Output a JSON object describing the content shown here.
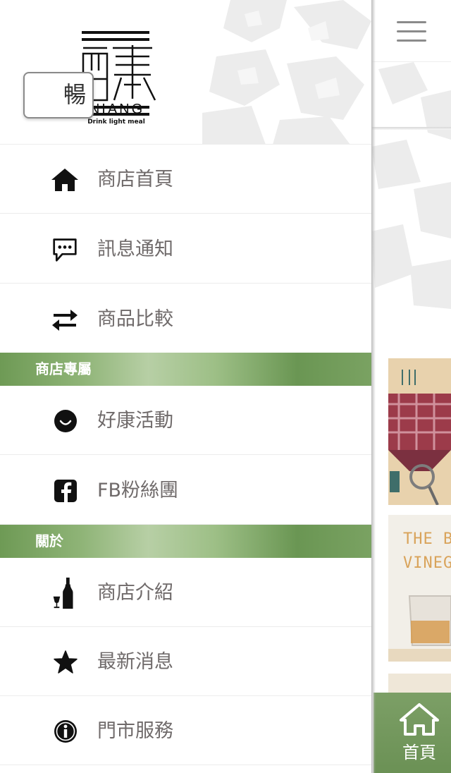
{
  "brand": {
    "wordmark": "NIANG",
    "tagline": "Drink light meal"
  },
  "menu": {
    "items_top": [
      {
        "label": "商店首頁",
        "icon": "home-icon"
      },
      {
        "label": "訊息通知",
        "icon": "chat-bubble-icon"
      },
      {
        "label": "商品比較",
        "icon": "swap-arrows-icon"
      }
    ],
    "section_store": "商店專屬",
    "items_store": [
      {
        "label": "好康活動",
        "icon": "smiley-icon"
      },
      {
        "label": "FB粉絲團",
        "icon": "facebook-icon"
      }
    ],
    "section_about": "關於",
    "items_about": [
      {
        "label": "商店介紹",
        "icon": "wine-bottle-icon"
      },
      {
        "label": "最新消息",
        "icon": "star-icon"
      },
      {
        "label": "門市服務",
        "icon": "info-icon"
      }
    ]
  },
  "main": {
    "tab_label": "暢",
    "card2_text": "THE BE\nVINEGE",
    "bottom_nav": {
      "home_label": "首頁",
      "icon": "home-icon"
    }
  },
  "colors": {
    "section_green": "#7aa262",
    "menu_text": "#6f6a6a",
    "bottom_tab_green": "#6b9155"
  }
}
